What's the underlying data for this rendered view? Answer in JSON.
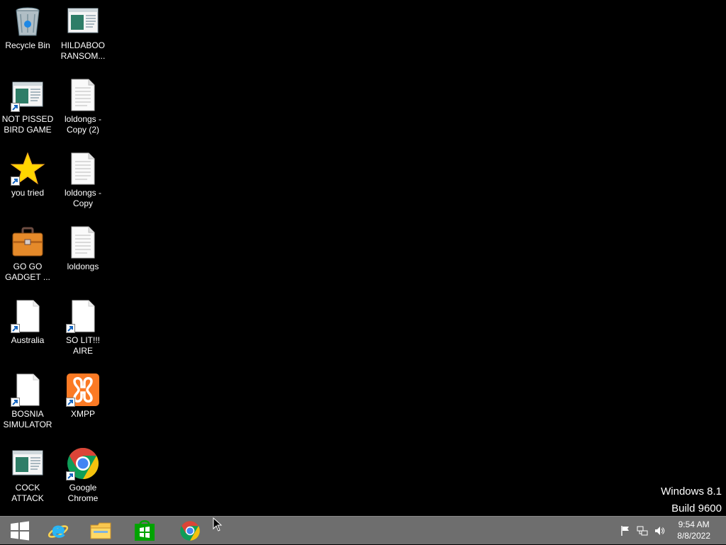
{
  "desktop": {
    "icons": [
      {
        "label": "Recycle Bin",
        "icon": "recycle-bin-icon"
      },
      {
        "label": "HILDABOO\nRANSOM...",
        "icon": "application-window-icon"
      },
      {
        "label": "NOT PISSED\nBIRD GAME",
        "icon": "application-window-icon"
      },
      {
        "label": "loldongs -\nCopy (2)",
        "icon": "text-document-icon"
      },
      {
        "label": "you tried",
        "icon": "star-icon"
      },
      {
        "label": "loldongs -\nCopy",
        "icon": "text-document-icon"
      },
      {
        "label": "GO GO\nGADGET ...",
        "icon": "briefcase-icon"
      },
      {
        "label": "loldongs",
        "icon": "text-document-icon"
      },
      {
        "label": "Australia",
        "icon": "blank-file-icon"
      },
      {
        "label": "SO LIT!!! AIRE",
        "icon": "blank-file-icon"
      },
      {
        "label": "BOSNIA\nSIMULATOR",
        "icon": "blank-file-icon"
      },
      {
        "label": "XMPP",
        "icon": "xampp-icon"
      },
      {
        "label": "COCK\nATTACK",
        "icon": "application-window-icon"
      },
      {
        "label": "Google\nChrome",
        "icon": "chrome-icon"
      }
    ]
  },
  "watermark": {
    "line1": "Windows 8.1",
    "line2": "Build 9600"
  },
  "taskbar": {
    "buttons": [
      "windows-start-icon",
      "internet-explorer-icon",
      "file-explorer-icon",
      "windows-store-icon",
      "chrome-icon"
    ],
    "tray": [
      "action-center-flag-icon",
      "network-icon",
      "volume-icon"
    ]
  },
  "clock": {
    "time": "9:54 AM",
    "date": "8/8/2022"
  },
  "colors": {
    "taskbar": "#6e6e6e",
    "desktop": "#000000",
    "chrome_red": "#db4437",
    "chrome_yellow": "#f4c20d",
    "chrome_green": "#0f9d58",
    "chrome_blue": "#4285f4",
    "xampp_orange": "#fb7a24",
    "store_green": "#00a300"
  }
}
